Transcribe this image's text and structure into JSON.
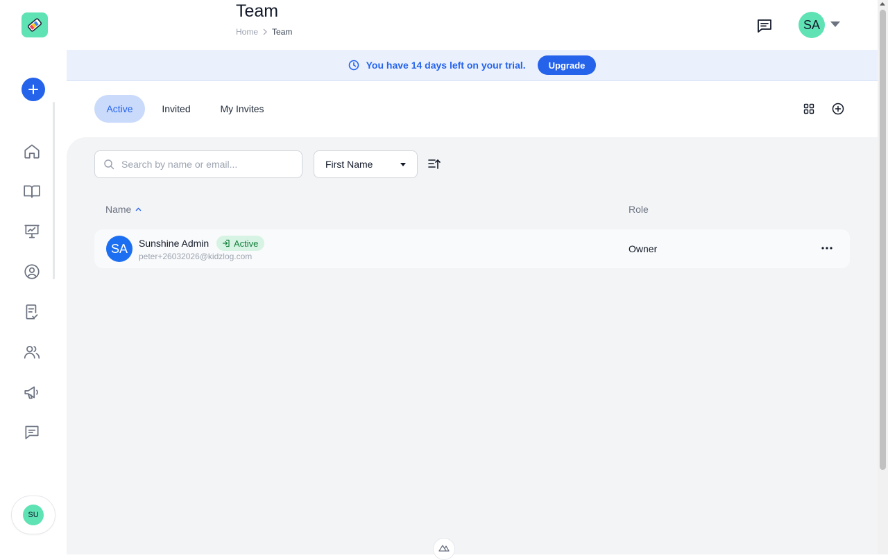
{
  "header": {
    "title": "Team",
    "breadcrumb": {
      "home": "Home",
      "current": "Team"
    },
    "avatar_initials": "SA"
  },
  "banner": {
    "message": "You have 14 days left on your trial.",
    "button_label": "Upgrade"
  },
  "tabs": [
    {
      "label": "Active",
      "active": true
    },
    {
      "label": "Invited",
      "active": false
    },
    {
      "label": "My Invites",
      "active": false
    }
  ],
  "filters": {
    "search_placeholder": "Search by name or email...",
    "sort_field": "First Name"
  },
  "table": {
    "columns": {
      "name": "Name",
      "role": "Role"
    },
    "rows": [
      {
        "initials": "SA",
        "name": "Sunshine Admin",
        "status": "Active",
        "email": "peter+26032026@kidzlog.com",
        "role": "Owner"
      }
    ]
  },
  "sidebar": {
    "user_initials": "SU",
    "nav_icons": [
      "home-icon",
      "book-icon",
      "presentation-icon",
      "user-circle-icon",
      "clipboard-check-icon",
      "users-icon",
      "megaphone-icon",
      "message-icon"
    ]
  },
  "colors": {
    "accent": "#2563eb",
    "brand_mint": "#5fe3b4",
    "status_active": "#15803d"
  }
}
